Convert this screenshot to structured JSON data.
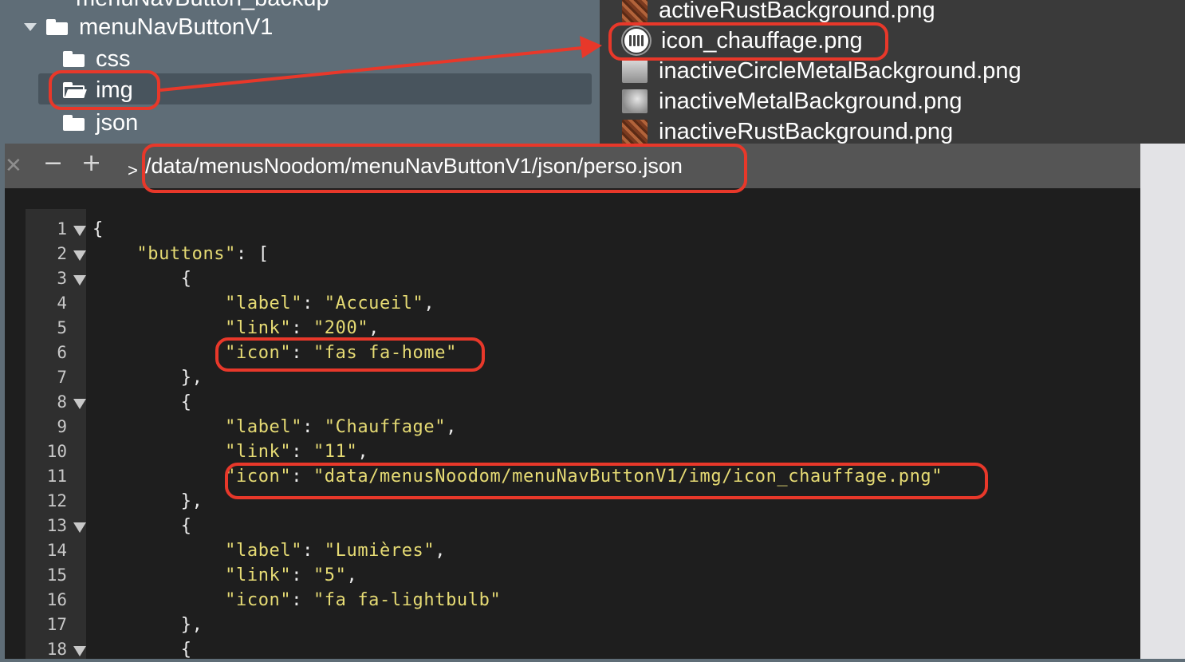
{
  "tree": {
    "items": [
      {
        "label": "menuNavButton_backup",
        "type": "folder"
      },
      {
        "label": "menuNavButtonV1",
        "type": "folder",
        "expanded": true
      },
      {
        "label": "css",
        "type": "folder"
      },
      {
        "label": "img",
        "type": "folder",
        "selected": true
      },
      {
        "label": "json",
        "type": "folder"
      }
    ]
  },
  "files": {
    "items": [
      {
        "label": "activeRustBackground.png",
        "icon": "rust-thumbnail"
      },
      {
        "label": "icon_chauffage.png",
        "icon": "radiator-thumbnail"
      },
      {
        "label": "inactiveCircleMetalBackground.png",
        "icon": "metal-thumbnail"
      },
      {
        "label": "inactiveMetalBackground.png",
        "icon": "metal-thumbnail"
      },
      {
        "label": "inactiveRustBackground.png",
        "icon": "rust-thumbnail"
      }
    ]
  },
  "editor": {
    "toolbar": {
      "close": "✕",
      "minus": "−",
      "plus": "+",
      "prefix": ">"
    },
    "path": "/data/menusNoodom/menuNavButtonV1/json/perso.json",
    "lines": [
      {
        "n": "1",
        "plain": "{",
        "str": ""
      },
      {
        "n": "2",
        "plain": "    ",
        "str": "\"buttons\"",
        "tail": ": ["
      },
      {
        "n": "3",
        "plain": "        {",
        "str": ""
      },
      {
        "n": "4",
        "plain": "            ",
        "str": "\"label\"",
        "tail": ": ",
        "str2": "\"Accueil\"",
        "tail2": ","
      },
      {
        "n": "5",
        "plain": "            ",
        "str": "\"link\"",
        "tail": ": ",
        "str2": "\"200\"",
        "tail2": ","
      },
      {
        "n": "6",
        "plain": "            ",
        "str": "\"icon\"",
        "tail": ": ",
        "str2": "\"fas fa-home\"",
        "tail2": ""
      },
      {
        "n": "7",
        "plain": "        },",
        "str": ""
      },
      {
        "n": "8",
        "plain": "        {",
        "str": ""
      },
      {
        "n": "9",
        "plain": "            ",
        "str": "\"label\"",
        "tail": ": ",
        "str2": "\"Chauffage\"",
        "tail2": ","
      },
      {
        "n": "10",
        "plain": "            ",
        "str": "\"link\"",
        "tail": ": ",
        "str2": "\"11\"",
        "tail2": ","
      },
      {
        "n": "11",
        "plain": "            ",
        "str": "\"icon\"",
        "tail": ": ",
        "str2": "\"data/menusNoodom/menuNavButtonV1/img/icon_chauffage.png\"",
        "tail2": ""
      },
      {
        "n": "12",
        "plain": "        },",
        "str": ""
      },
      {
        "n": "13",
        "plain": "        {",
        "str": ""
      },
      {
        "n": "14",
        "plain": "            ",
        "str": "\"label\"",
        "tail": ": ",
        "str2": "\"Lumières\"",
        "tail2": ","
      },
      {
        "n": "15",
        "plain": "            ",
        "str": "\"link\"",
        "tail": ": ",
        "str2": "\"5\"",
        "tail2": ","
      },
      {
        "n": "16",
        "plain": "            ",
        "str": "\"icon\"",
        "tail": ": ",
        "str2": "\"fa fa-lightbulb\"",
        "tail2": ""
      },
      {
        "n": "17",
        "plain": "        },",
        "str": ""
      },
      {
        "n": "18",
        "plain": "        {",
        "str": ""
      }
    ],
    "folded_lines": [
      "1",
      "2",
      "3",
      "8",
      "13",
      "18"
    ]
  },
  "colors": {
    "annotation": "#e8382a",
    "string": "#e6db74",
    "editor_bg": "#1e1e1e",
    "tree_bg": "#5f6d77"
  }
}
